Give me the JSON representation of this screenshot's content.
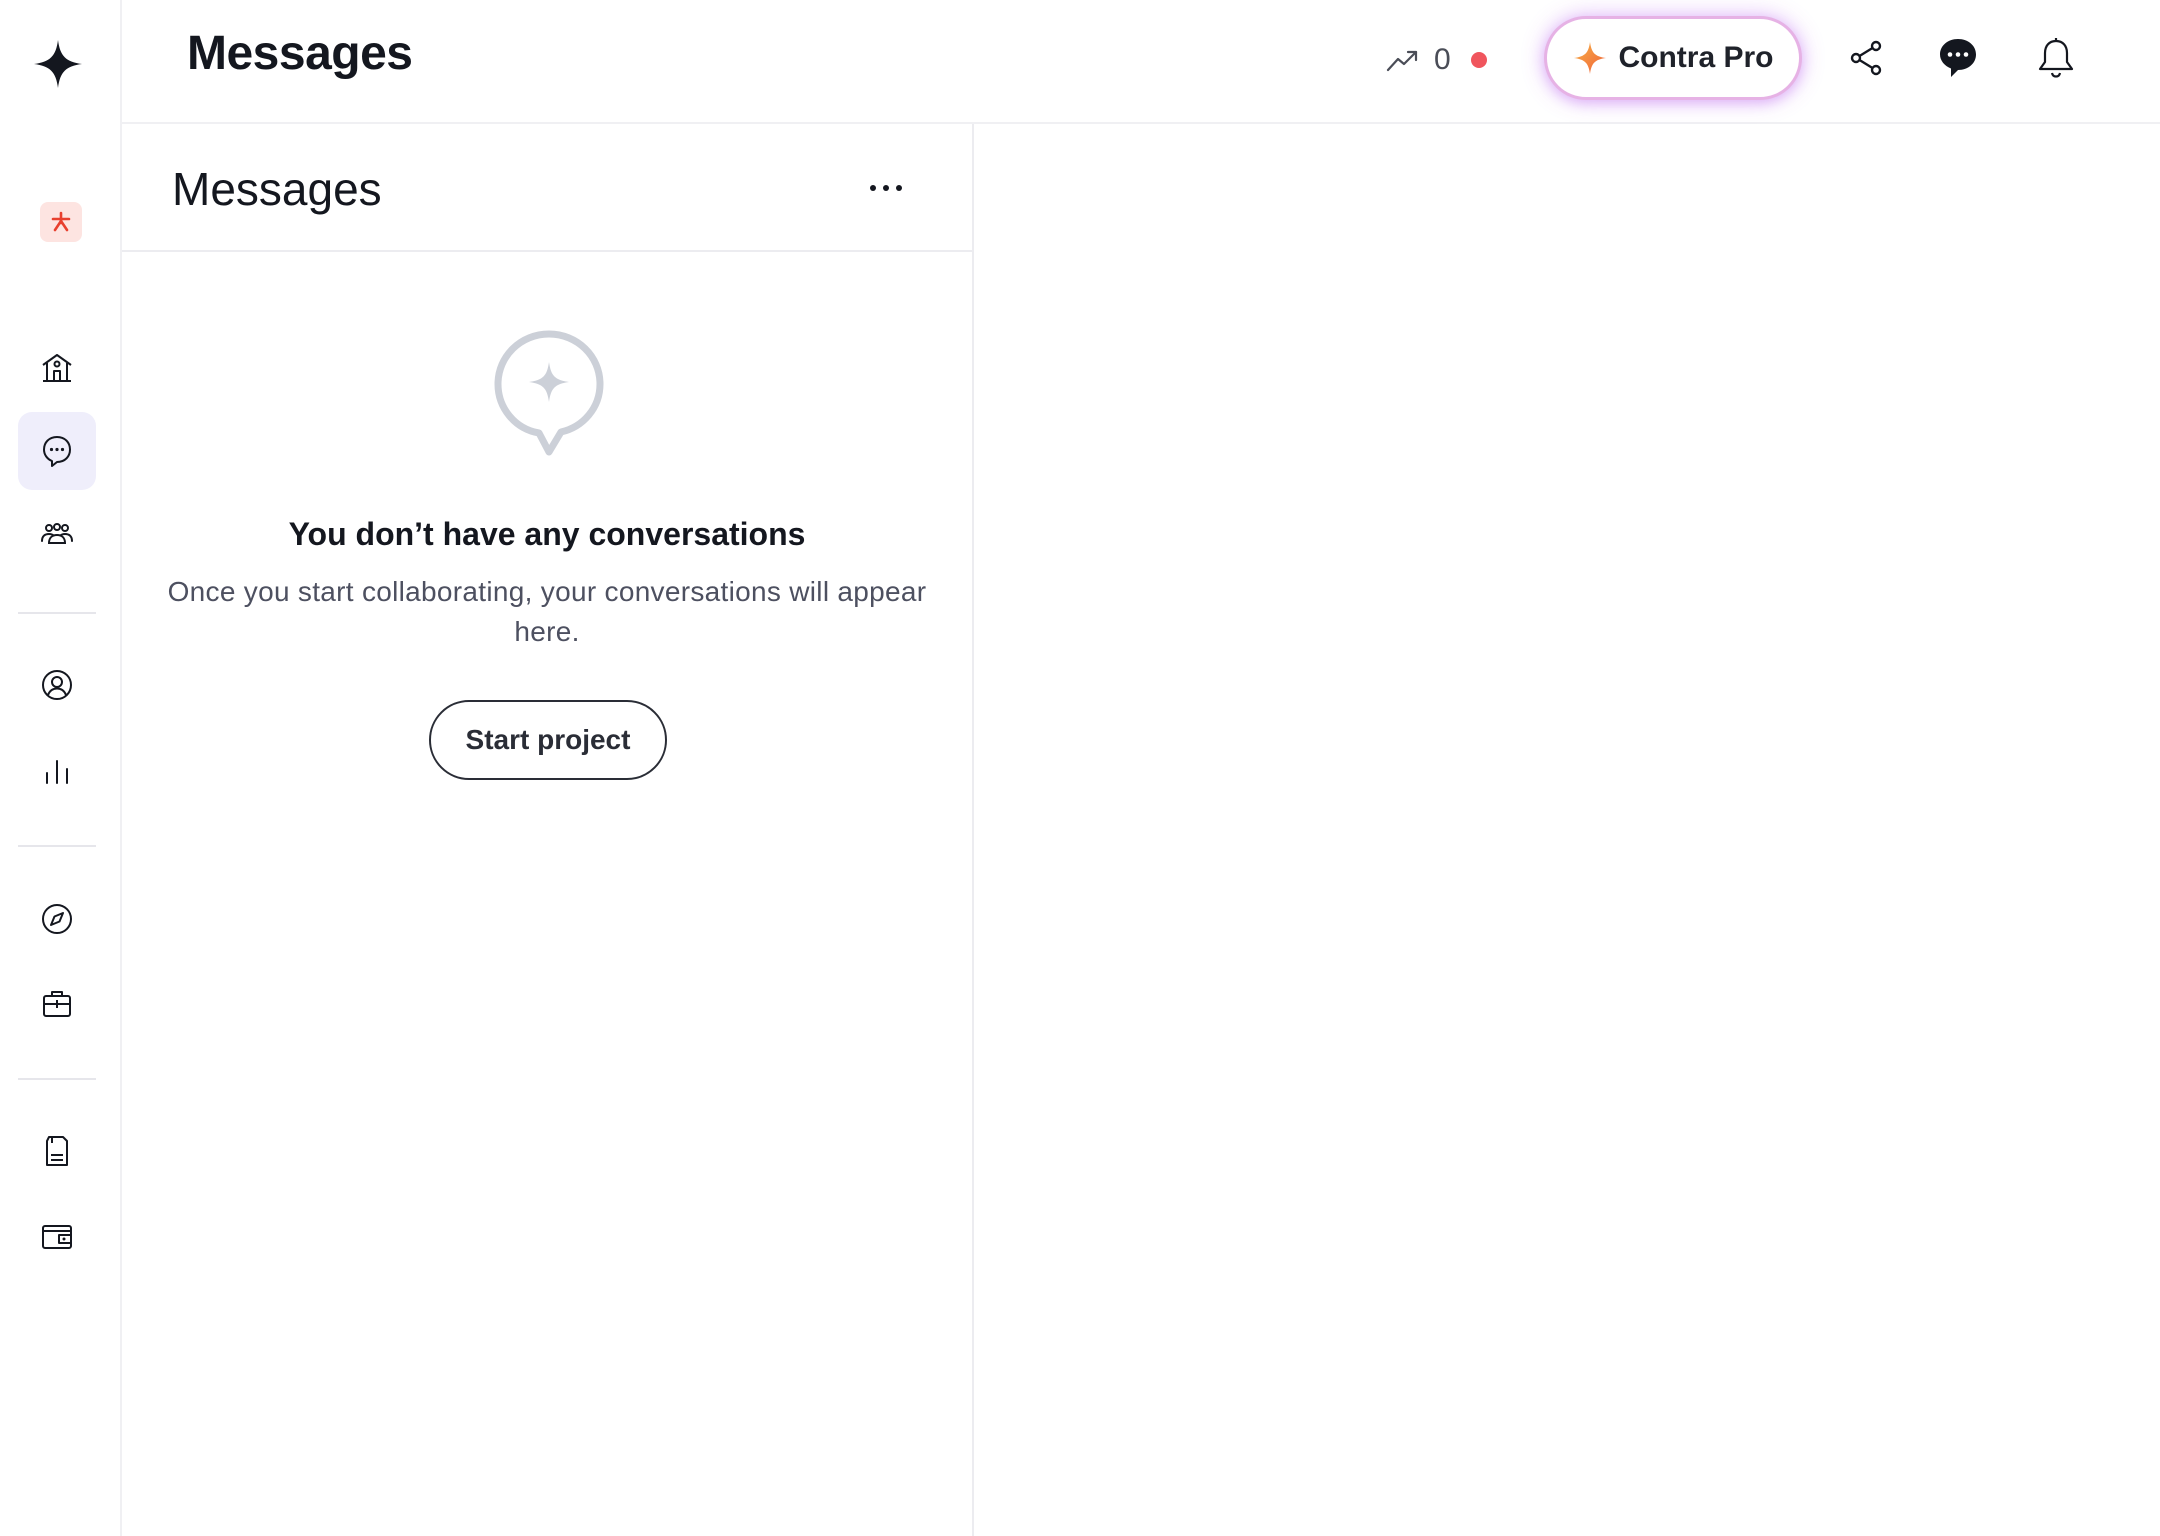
{
  "header": {
    "title": "Messages",
    "stat_count": "0",
    "pro_button_label": "Contra Pro"
  },
  "sidebar": {
    "items": [
      {
        "name": "home",
        "icon": "building-icon",
        "active": false
      },
      {
        "name": "messages",
        "icon": "chat-bubble-icon",
        "active": true
      },
      {
        "name": "community",
        "icon": "people-icon",
        "active": false
      },
      {
        "name": "profile",
        "icon": "user-circle-icon",
        "active": false
      },
      {
        "name": "analytics",
        "icon": "bar-chart-icon",
        "active": false
      },
      {
        "name": "discover",
        "icon": "compass-icon",
        "active": false
      },
      {
        "name": "jobs",
        "icon": "briefcase-icon",
        "active": false
      },
      {
        "name": "invoices",
        "icon": "document-icon",
        "active": false
      },
      {
        "name": "wallet",
        "icon": "wallet-icon",
        "active": false
      }
    ]
  },
  "messages_panel": {
    "title": "Messages",
    "empty_state": {
      "title": "You don’t have any conversations",
      "body": "Once you start collaborating, your conversations will appear here.",
      "button_label": "Start project"
    }
  },
  "colors": {
    "accent_active_bg": "#efeefb",
    "notification_dot": "#f0555d",
    "workspace_badge_bg": "#fde4e1",
    "workspace_badge_fg": "#e8402f",
    "pro_glow": "#b55cf2"
  }
}
